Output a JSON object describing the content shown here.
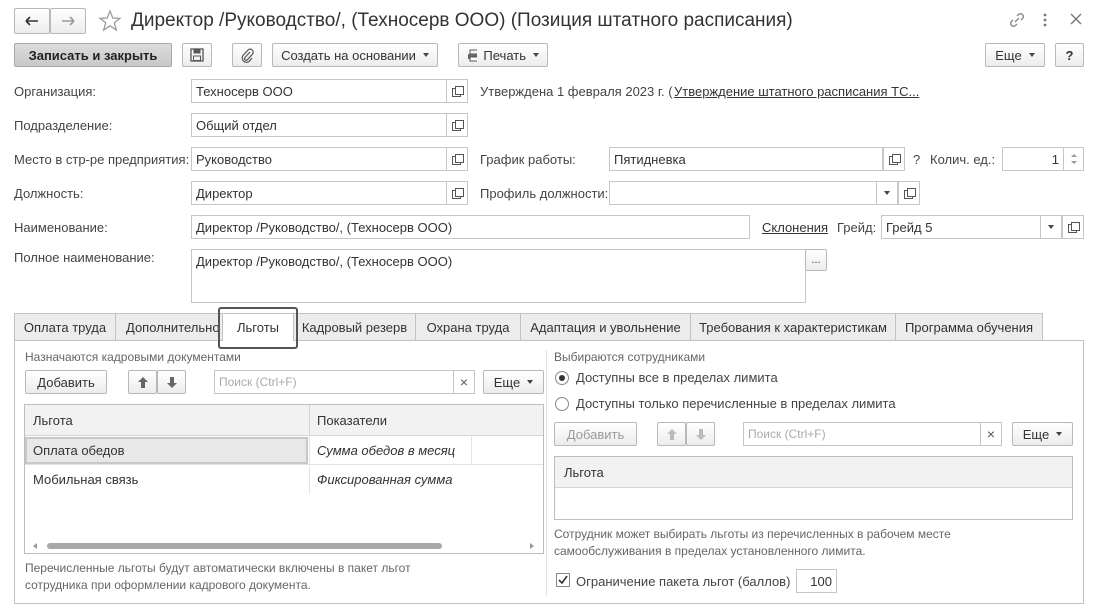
{
  "window": {
    "title": "Директор /Руководство/, (Техносерв ООО) (Позиция штатного расписания)"
  },
  "toolbar": {
    "save_close": "Записать и закрыть",
    "create_based": "Создать на основании",
    "print": "Печать",
    "more": "Еще",
    "help": "?"
  },
  "form": {
    "org_label": "Организация:",
    "org_value": "Техносерв ООО",
    "approved_text": "Утверждена 1 февраля 2023 г. (",
    "approved_link": "Утверждение штатного расписания ТС...",
    "dept_label": "Подразделение:",
    "dept_value": "Общий отдел",
    "place_label": "Место в стр-ре предприятия:",
    "place_value": "Руководство",
    "schedule_label": "График работы:",
    "schedule_value": "Пятидневка",
    "question": "?",
    "qty_label": "Колич. ед.:",
    "qty_value": "1",
    "position_label": "Должность:",
    "position_value": "Директор",
    "profile_label": "Профиль должности:",
    "profile_value": "",
    "name_label": "Наименование:",
    "name_value": "Директор /Руководство/, (Техносерв ООО)",
    "declension_link": "Склонения",
    "grade_label": "Грейд:",
    "grade_value": "Грейд 5",
    "fullname_label": "Полное наименование:",
    "fullname_value": "Директор /Руководство/, (Техносерв ООО)",
    "ellipsis": "..."
  },
  "tabs": [
    {
      "label": "Оплата труда"
    },
    {
      "label": "Дополнительно"
    },
    {
      "label": "Льготы"
    },
    {
      "label": "Кадровый резерв"
    },
    {
      "label": "Охрана труда"
    },
    {
      "label": "Адаптация и увольнение"
    },
    {
      "label": "Требования к характеристикам"
    },
    {
      "label": "Программа обучения"
    }
  ],
  "left": {
    "heading": "Назначаются кадровыми документами",
    "add": "Добавить",
    "search_placeholder": "Поиск (Ctrl+F)",
    "clear": "×",
    "more": "Еще",
    "columns": [
      "Льгота",
      "Показатели"
    ],
    "rows": [
      {
        "benefit": "Оплата обедов",
        "indicator": "Сумма обедов в месяц"
      },
      {
        "benefit": "Мобильная связь",
        "indicator": "Фиксированная сумма"
      }
    ],
    "note": "Перечисленные льготы будут автоматически включены в пакет льгот сотрудника при оформлении кадрового документа."
  },
  "right": {
    "heading": "Выбираются сотрудниками",
    "radio1": "Доступны все в пределах лимита",
    "radio2": "Доступны только перечисленные в пределах лимита",
    "add": "Добавить",
    "search_placeholder": "Поиск (Ctrl+F)",
    "clear": "×",
    "more": "Еще",
    "column": "Льгота",
    "note": "Сотрудник может выбирать льготы из перечисленных в рабочем месте самообслуживания в пределах установленного лимита.",
    "limit_label": "Ограничение пакета льгот (баллов)",
    "limit_checked": true,
    "limit_value": "100"
  }
}
